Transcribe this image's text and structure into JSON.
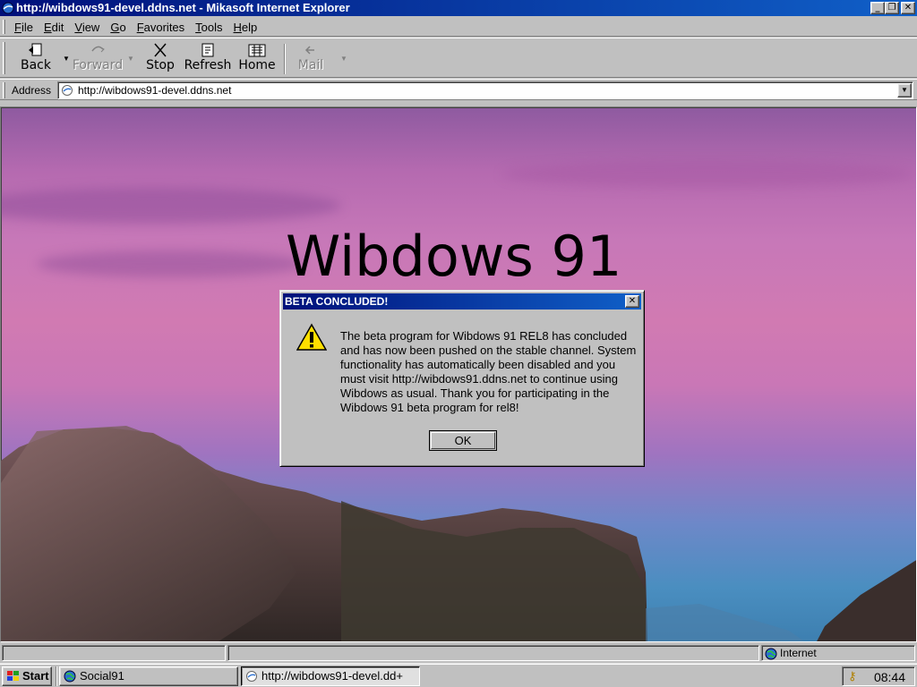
{
  "window": {
    "title": "http://wibdows91-devel.ddns.net - Mikasoft Internet Explorer",
    "minimize_glyph": "_",
    "maximize_glyph": "❐",
    "close_glyph": "✕"
  },
  "menu": {
    "items": [
      "File",
      "Edit",
      "View",
      "Go",
      "Favorites",
      "Tools",
      "Help"
    ]
  },
  "toolbar": {
    "back": {
      "label": "Back",
      "icon": "back-icon"
    },
    "forward": {
      "label": "Forward",
      "icon": "forward-icon"
    },
    "stop": {
      "label": "Stop",
      "icon": "stop-icon"
    },
    "refresh": {
      "label": "Refresh",
      "icon": "refresh-icon"
    },
    "home": {
      "label": "Home",
      "icon": "home-icon"
    },
    "mail": {
      "label": "Mail",
      "icon": "mail-icon"
    }
  },
  "address": {
    "label": "Address",
    "url": "http://wibdows91-devel.ddns.net"
  },
  "page": {
    "heading": "Wibdows 91"
  },
  "dialog": {
    "title": "BETA CONCLUDED!",
    "message": "The beta program for Wibdows 91 REL8 has concluded and has now been pushed on the stable channel. System functionality has automatically been disabled and you must visit http://wibdows91.ddns.net to continue using Wibdows as usual. Thank you for participating in the Wibdows 91 beta program for rel8!",
    "ok_label": "OK",
    "icon": "warning-icon"
  },
  "status": {
    "zone": "Internet"
  },
  "taskbar": {
    "start_label": "Start",
    "tasks": [
      {
        "label": "Social91",
        "active": false
      },
      {
        "label": "http://wibdows91-devel.dd+",
        "active": true
      }
    ],
    "clock": "08:44"
  },
  "colors": {
    "titlebar_start": "#00107a",
    "titlebar_end": "#1060c8",
    "chrome": "#c0c0c0"
  }
}
